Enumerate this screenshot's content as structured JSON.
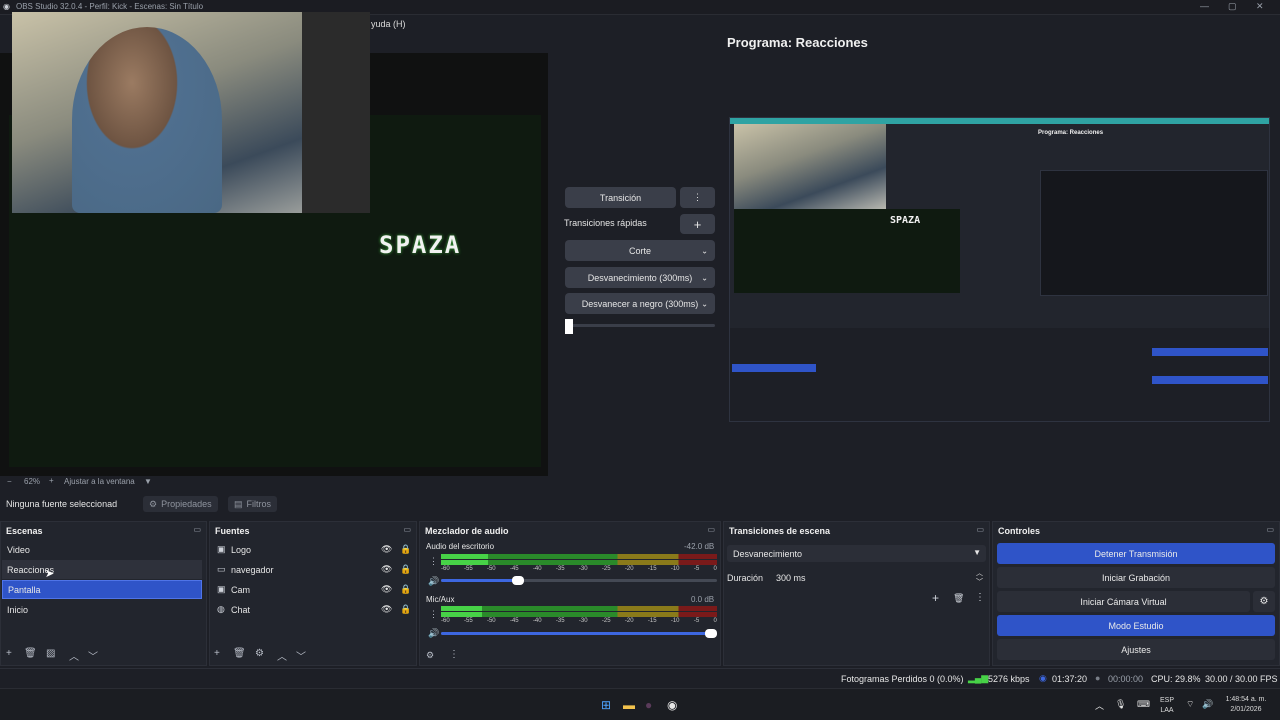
{
  "window": {
    "title": "OBS Studio 32.0.4 - Perfil: Kick - Escenas: Sin Título",
    "menu_partial": "yuda (H)"
  },
  "preview": {
    "overlay_text": "SPAZA",
    "zoom": "62%",
    "zoom_minus": "−",
    "zoom_plus": "+",
    "fit_label": "Ajustar a la ventana"
  },
  "program": {
    "title": "Programa: Reacciones"
  },
  "transitions_panel": {
    "transition_button": "Transición",
    "quick_label": "Transiciones rápidas",
    "items": [
      "Corte",
      "Desvanecimiento (300ms)",
      "Desvanecer a negro (300ms)"
    ]
  },
  "source_toolbar": {
    "no_selection": "Ninguna fuente seleccionad",
    "properties": "Propiedades",
    "filters": "Filtros"
  },
  "scenes": {
    "title": "Escenas",
    "items": [
      "Video",
      "Reacciones",
      "Pantalla",
      "Inicio"
    ],
    "selected": "Pantalla"
  },
  "sources": {
    "title": "Fuentes",
    "items": [
      "Logo",
      "navegador",
      "Cam",
      "Chat"
    ]
  },
  "mixer": {
    "title": "Mezclador de audio",
    "channels": [
      {
        "name": "Audio del escritorio",
        "db": "-42.0 dB",
        "level": 0.17,
        "volume": 0.27
      },
      {
        "name": "Mic/Aux",
        "db": "0.0 dB",
        "level": 0.15,
        "volume": 1.0
      }
    ],
    "scale": [
      "-60",
      "-55",
      "-50",
      "-45",
      "-40",
      "-35",
      "-30",
      "-25",
      "-20",
      "-15",
      "-10",
      "-5",
      "0"
    ]
  },
  "scene_transitions": {
    "title": "Transiciones de escena",
    "selected": "Desvanecimiento",
    "duration_label": "Duración",
    "duration_value": "300 ms"
  },
  "controls": {
    "title": "Controles",
    "buttons": [
      "Detener Transmisión",
      "Iniciar Grabación",
      "Iniciar Cámara Virtual",
      "Modo Estudio",
      "Ajustes"
    ]
  },
  "status": {
    "dropped": "Fotogramas Perdidos 0 (0.0%)",
    "bitrate": "5276 kbps",
    "stream_time": "01:37:20",
    "rec_time": "00:00:00",
    "cpu": "CPU: 29.8%",
    "fps": "30.00 / 30.00 FPS"
  },
  "taskbar": {
    "lang": "ESP",
    "layout": "LAA",
    "time": "1:48:54 a. m.",
    "date": "2/01/2026"
  },
  "colors": {
    "accent": "#2f54c8",
    "panel": "#22252d",
    "background": "#1d1f26"
  }
}
